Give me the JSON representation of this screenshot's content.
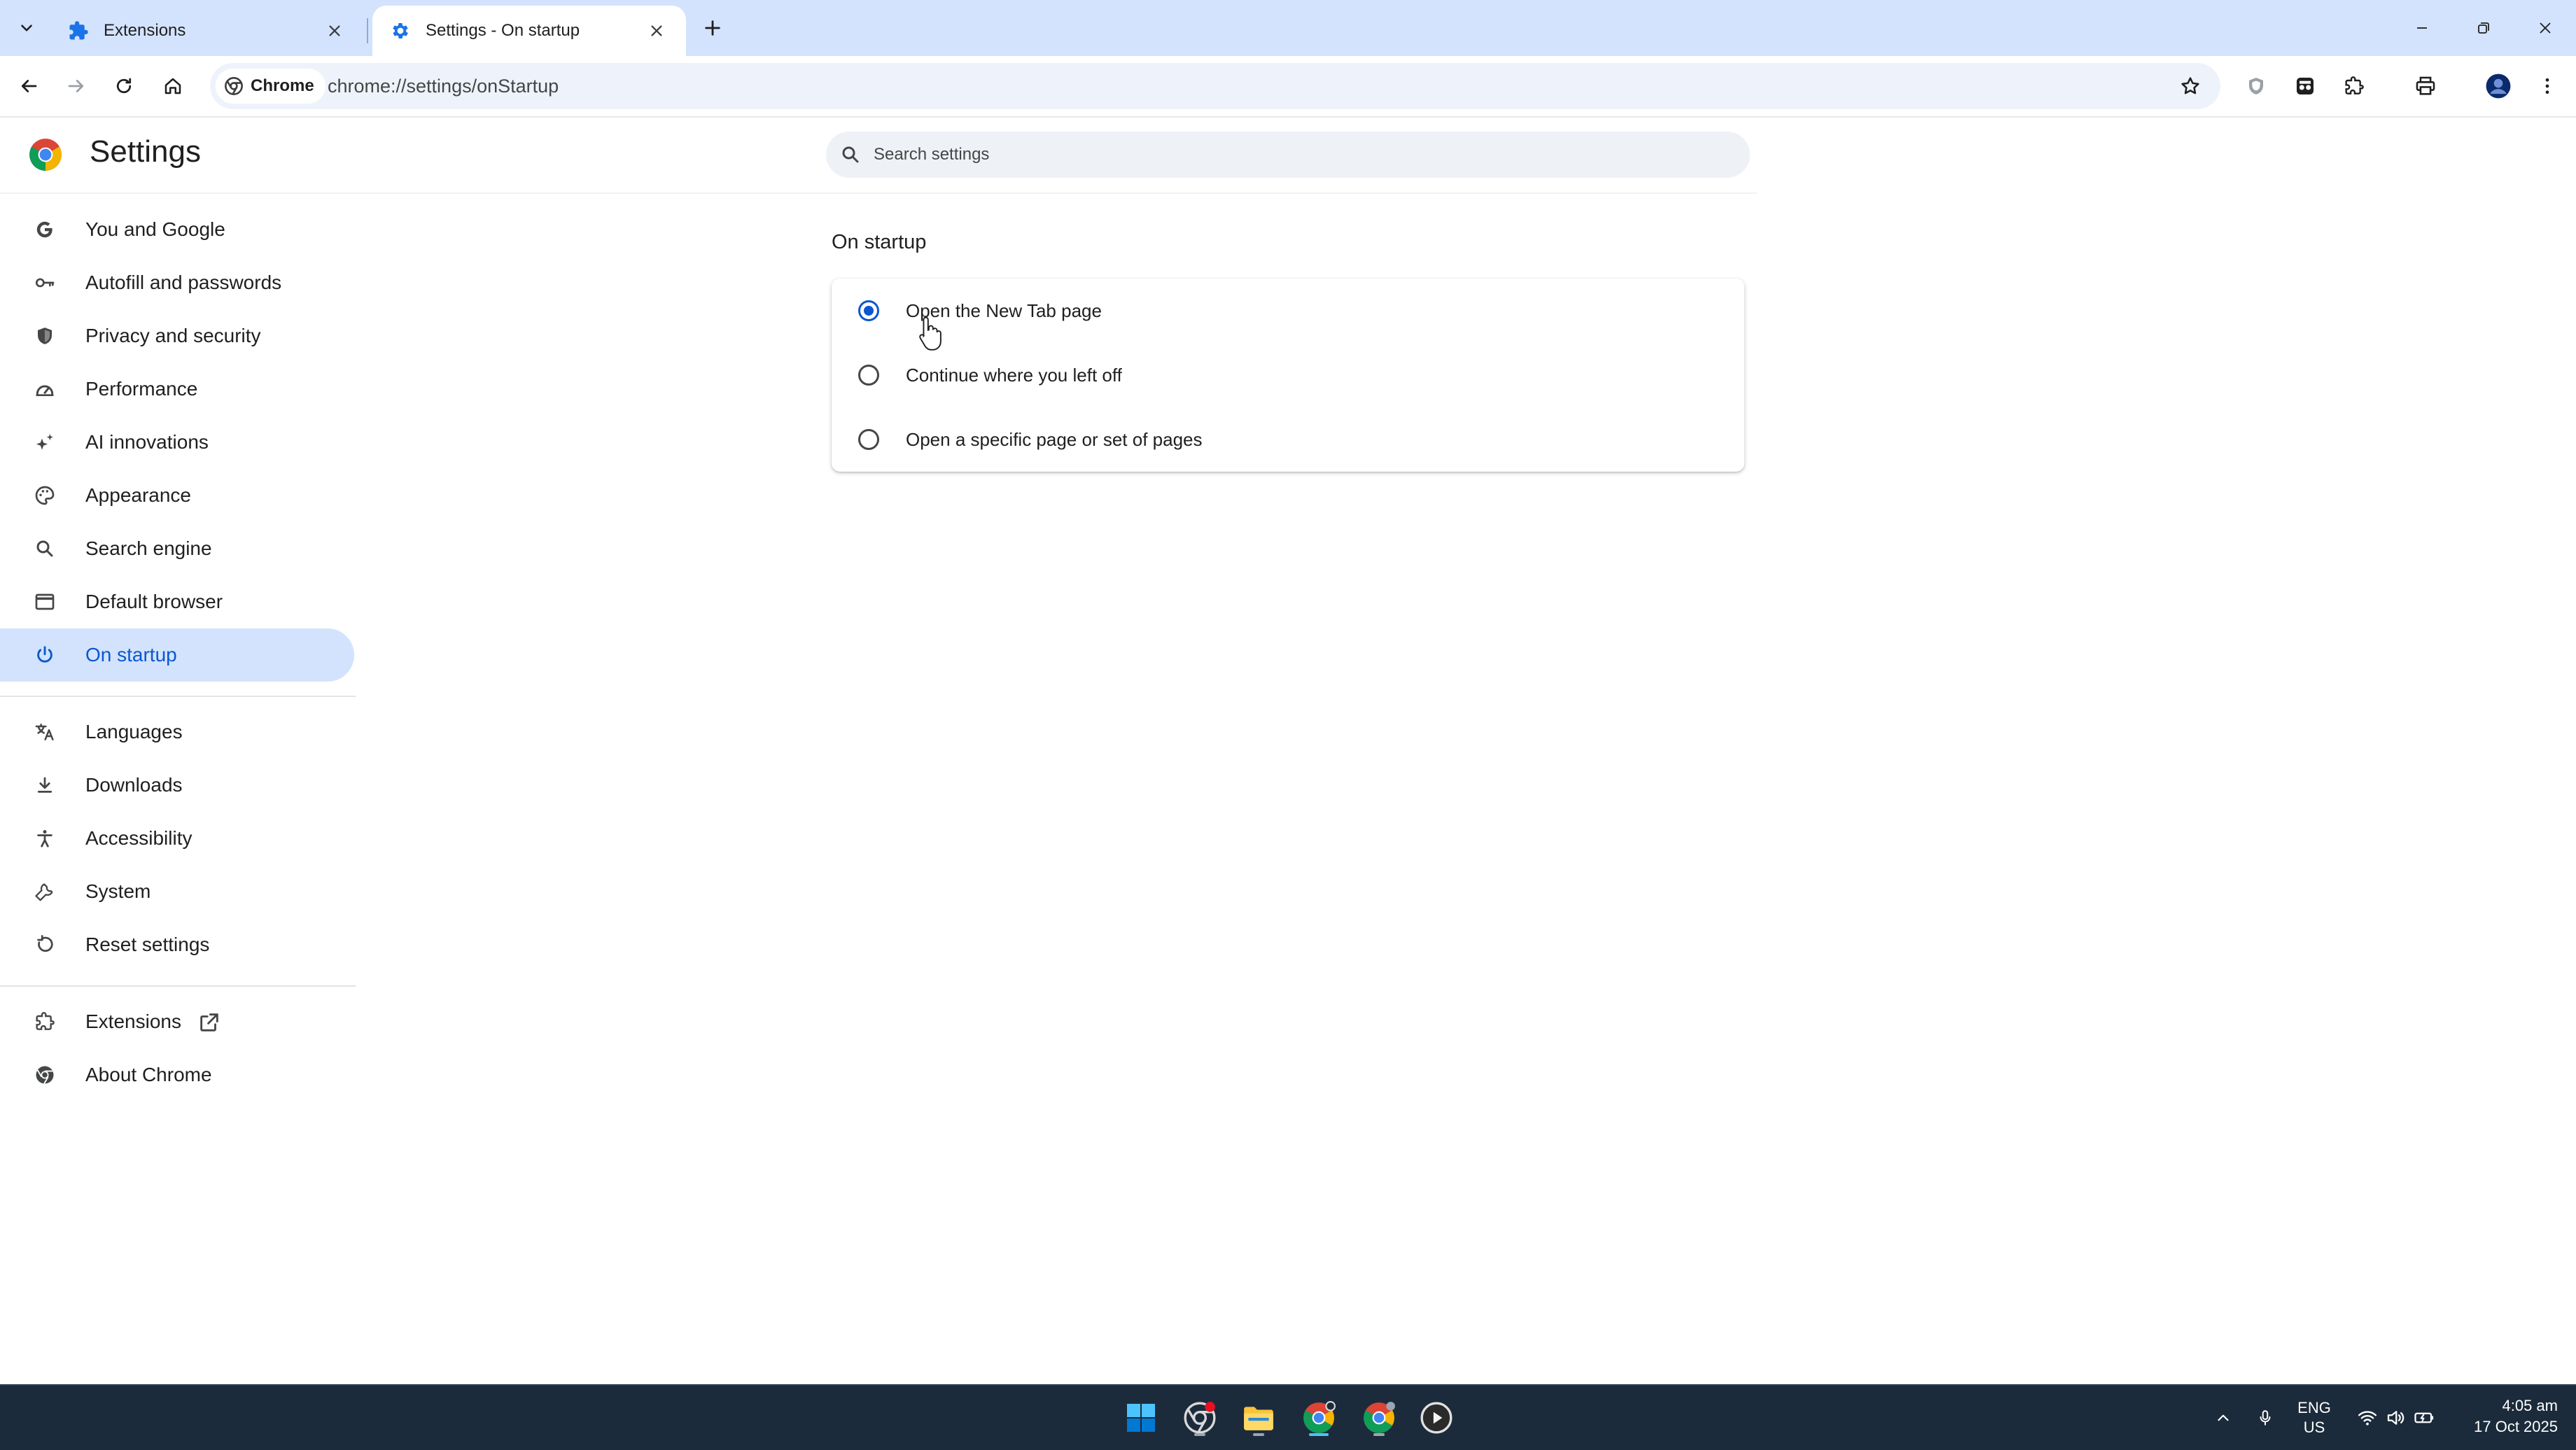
{
  "tabs": [
    {
      "title": "Extensions",
      "icon": "puzzle-icon",
      "active": false
    },
    {
      "title": "Settings - On startup",
      "icon": "gear-icon",
      "active": true
    }
  ],
  "toolbar": {
    "chip_label": "Chrome",
    "url": "chrome://settings/onStartup"
  },
  "settings": {
    "title": "Settings",
    "search_placeholder": "Search settings"
  },
  "sidebar": {
    "items": [
      {
        "label": "You and Google",
        "icon": "google-g-icon"
      },
      {
        "label": "Autofill and passwords",
        "icon": "key-icon"
      },
      {
        "label": "Privacy and security",
        "icon": "shield-icon"
      },
      {
        "label": "Performance",
        "icon": "speedometer-icon"
      },
      {
        "label": "AI innovations",
        "icon": "sparkle-icon"
      },
      {
        "label": "Appearance",
        "icon": "palette-icon"
      },
      {
        "label": "Search engine",
        "icon": "search-icon"
      },
      {
        "label": "Default browser",
        "icon": "browser-window-icon"
      },
      {
        "label": "On startup",
        "icon": "power-icon",
        "selected": true
      },
      {
        "label": "Languages",
        "icon": "translate-icon"
      },
      {
        "label": "Downloads",
        "icon": "download-icon"
      },
      {
        "label": "Accessibility",
        "icon": "accessibility-icon"
      },
      {
        "label": "System",
        "icon": "wrench-icon"
      },
      {
        "label": "Reset settings",
        "icon": "reset-icon"
      },
      {
        "label": "Extensions",
        "icon": "puzzle-icon"
      },
      {
        "label": "About Chrome",
        "icon": "chrome-icon"
      }
    ]
  },
  "startup": {
    "section_title": "On startup",
    "options": [
      {
        "label": "Open the New Tab page",
        "checked": true
      },
      {
        "label": "Continue where you left off",
        "checked": false
      },
      {
        "label": "Open a specific page or set of pages",
        "checked": false
      }
    ]
  },
  "taskbar": {
    "lang_line1": "ENG",
    "lang_line2": "US",
    "time": "4:05 am",
    "date": "17 Oct 2025"
  },
  "colors": {
    "accent": "#0b57d0",
    "tabstrip": "#d3e3fd",
    "taskbar": "#1c2b3b"
  }
}
